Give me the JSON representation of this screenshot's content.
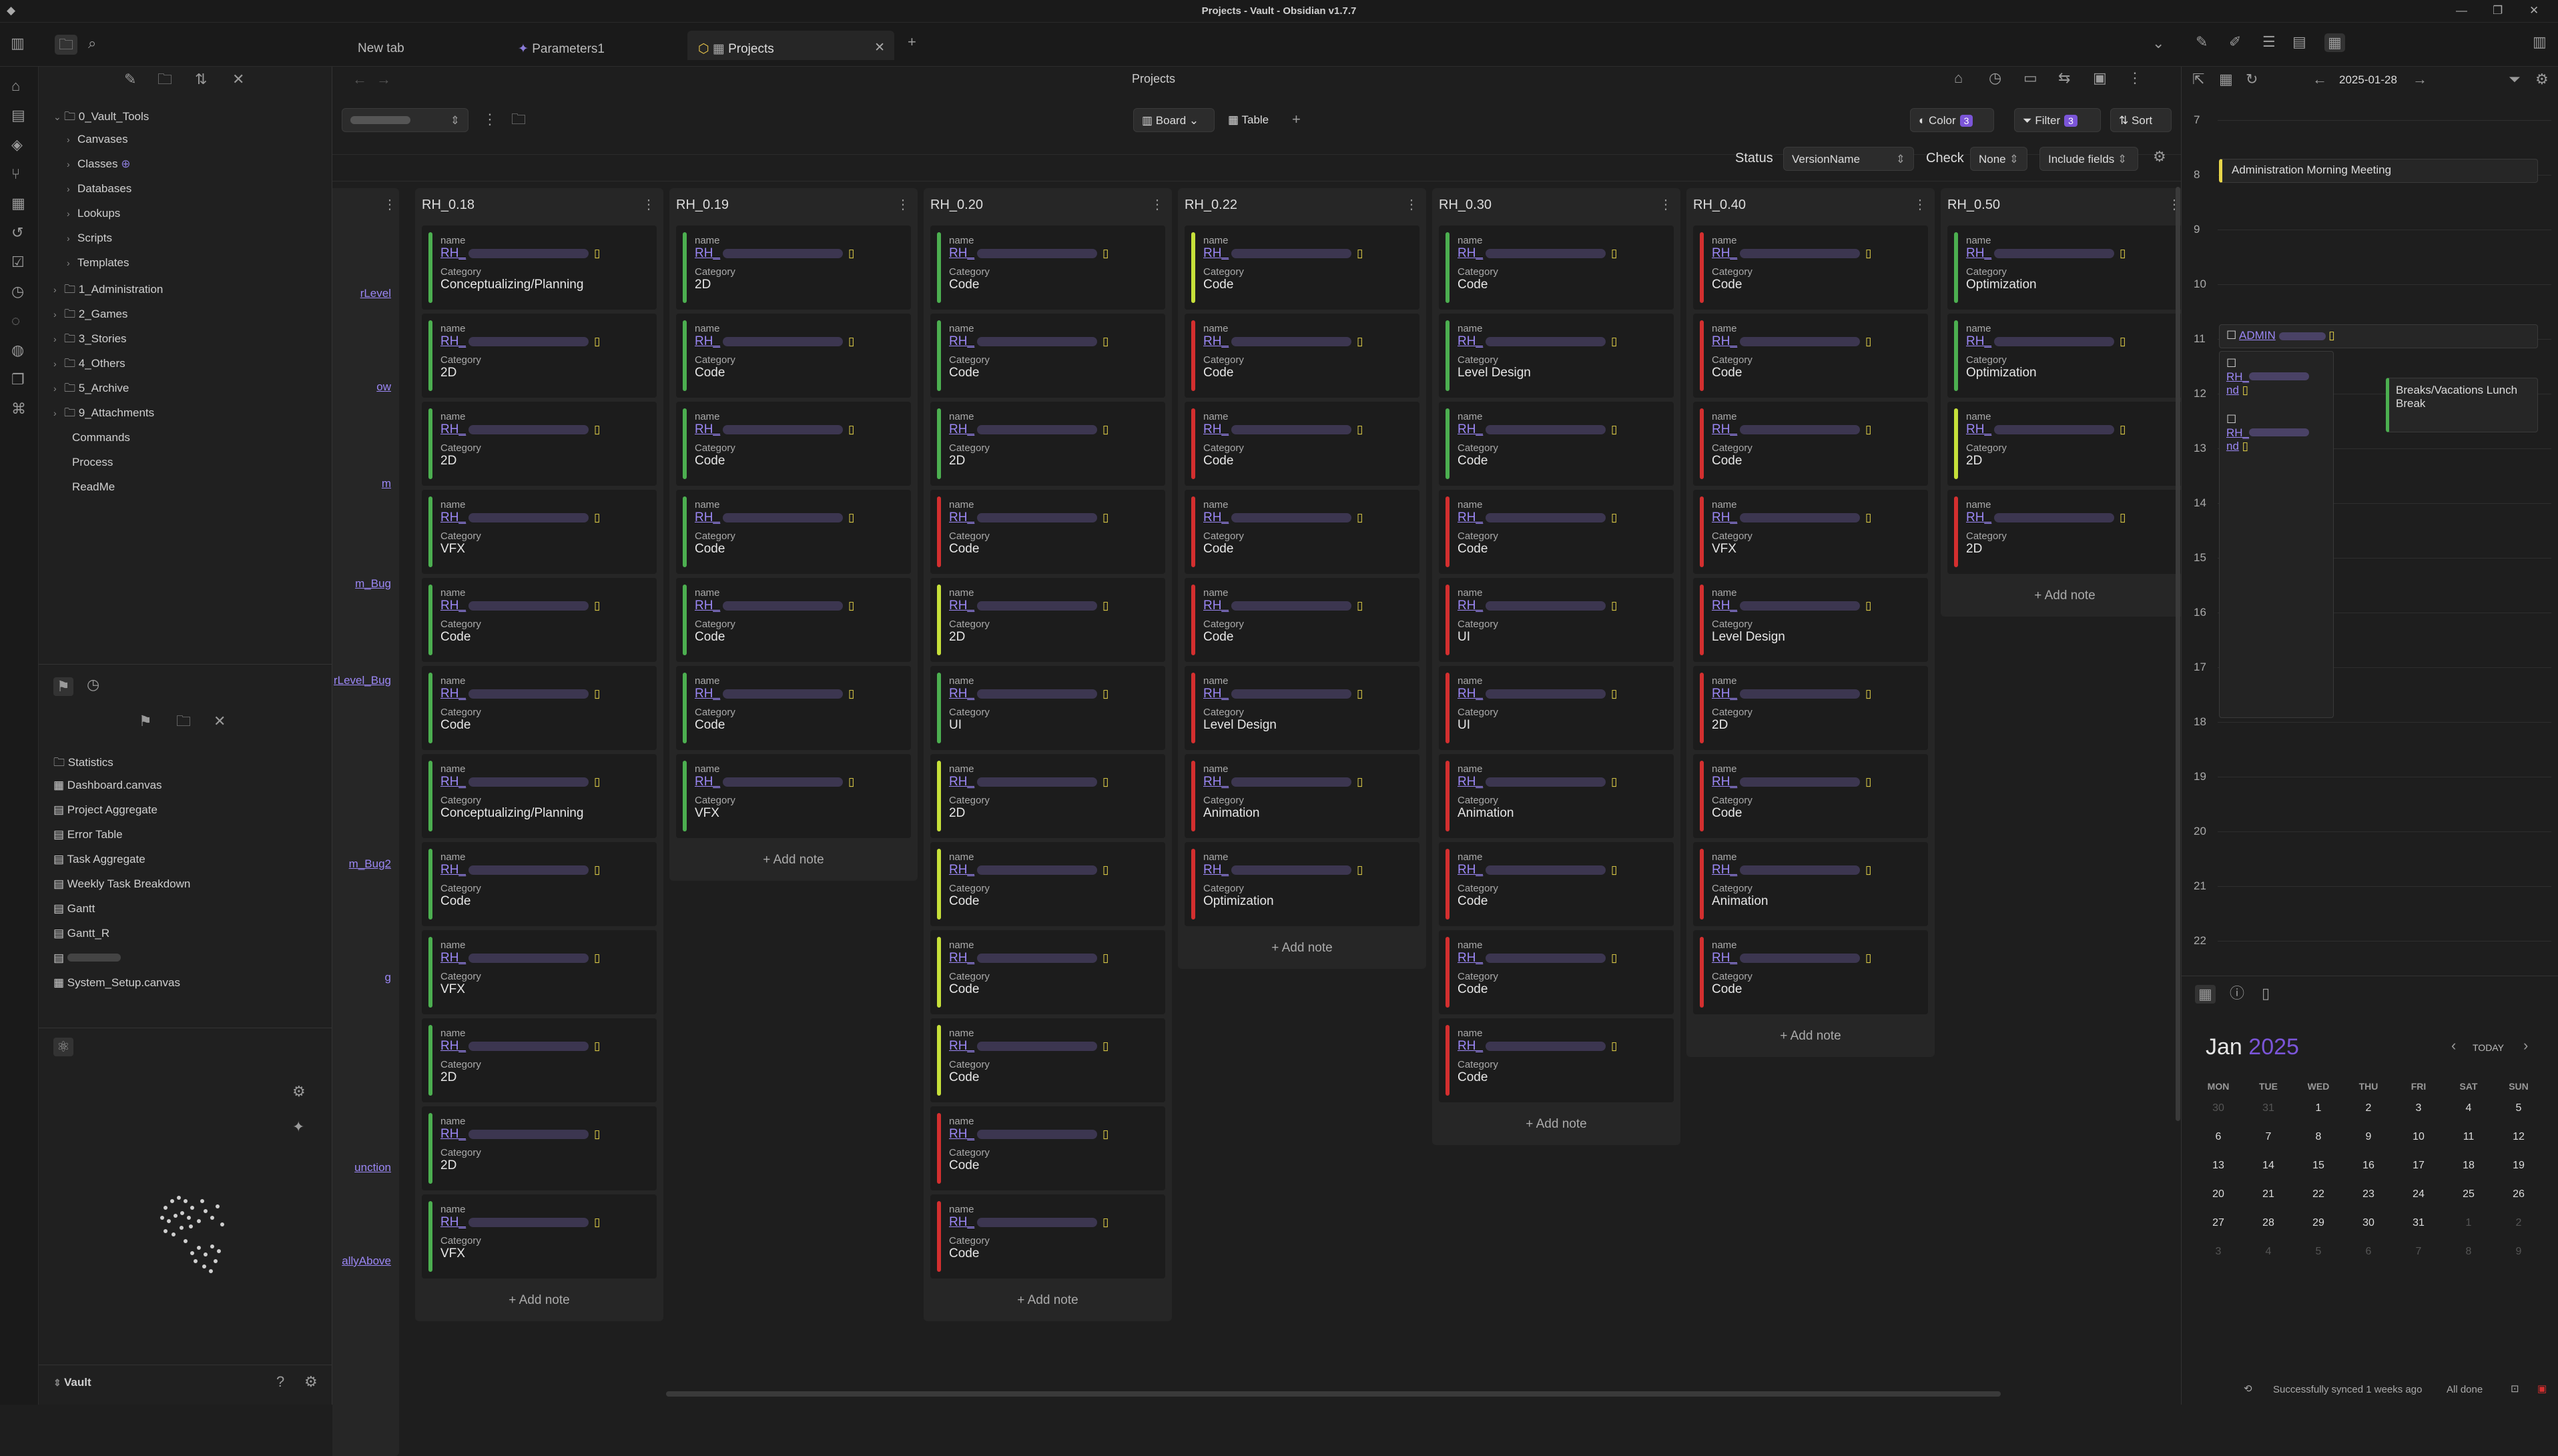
{
  "window": {
    "title": "Projects - Vault - Obsidian v1.7.7"
  },
  "tabs": [
    {
      "label": "New tab"
    },
    {
      "label": "Parameters1"
    },
    {
      "label": "Projects"
    }
  ],
  "explorer": {
    "root": "0_Vault_Tools",
    "children": [
      "Canvases",
      "Classes",
      "Databases",
      "Lookups",
      "Scripts",
      "Templates"
    ],
    "folders": [
      "1_Administration",
      "2_Games",
      "3_Stories",
      "4_Others",
      "5_Archive",
      "9_Attachments"
    ],
    "files": [
      "Commands",
      "Process",
      "ReadMe"
    ]
  },
  "bookmarks": [
    "Statistics",
    "Dashboard.canvas",
    "Project Aggregate",
    "Error Table",
    "Task Aggregate",
    "Weekly Task Breakdown",
    "Gantt",
    "Gantt_R",
    "System_Setup.canvas"
  ],
  "vault": {
    "name": "Vault"
  },
  "main": {
    "title": "Projects",
    "views": {
      "board": "Board",
      "table": "Table"
    },
    "buttons": {
      "color": "Color",
      "color_count": "3",
      "filter": "Filter",
      "filter_count": "3",
      "sort": "Sort"
    },
    "status_label": "Status",
    "status_value": "VersionName",
    "check_label": "Check",
    "check_value": "None",
    "include_fields": "Include fields",
    "add_note": "Add note",
    "field_name": "name",
    "field_category": "Category",
    "link_prefix": "RH_",
    "partial_links": [
      "rLevel",
      "ow",
      "m",
      "m_Bug",
      "rLevel_Bug",
      "m_Bug2",
      "g",
      "unction",
      "allyAbove"
    ],
    "columns": [
      {
        "title": "RH_0.18",
        "cards": [
          {
            "cat": "Conceptualizing/Planning",
            "color": "#4caf50"
          },
          {
            "cat": "2D",
            "color": "#4caf50"
          },
          {
            "cat": "2D",
            "color": "#4caf50"
          },
          {
            "cat": "VFX",
            "color": "#4caf50"
          },
          {
            "cat": "Code",
            "color": "#4caf50"
          },
          {
            "cat": "Code",
            "color": "#4caf50"
          },
          {
            "cat": "Conceptualizing/Planning",
            "color": "#4caf50"
          },
          {
            "cat": "Code",
            "color": "#4caf50"
          },
          {
            "cat": "VFX",
            "color": "#4caf50"
          },
          {
            "cat": "2D",
            "color": "#4caf50"
          },
          {
            "cat": "2D",
            "color": "#4caf50"
          },
          {
            "cat": "VFX",
            "color": "#4caf50"
          }
        ]
      },
      {
        "title": "RH_0.19",
        "cards": [
          {
            "cat": "2D",
            "color": "#4caf50"
          },
          {
            "cat": "Code",
            "color": "#4caf50"
          },
          {
            "cat": "Code",
            "color": "#4caf50"
          },
          {
            "cat": "Code",
            "color": "#4caf50"
          },
          {
            "cat": "Code",
            "color": "#4caf50"
          },
          {
            "cat": "Code",
            "color": "#4caf50"
          },
          {
            "cat": "VFX",
            "color": "#4caf50"
          }
        ]
      },
      {
        "title": "RH_0.20",
        "cards": [
          {
            "cat": "Code",
            "color": "#4caf50"
          },
          {
            "cat": "Code",
            "color": "#4caf50"
          },
          {
            "cat": "2D",
            "color": "#4caf50"
          },
          {
            "cat": "Code",
            "color": "#d32f2f"
          },
          {
            "cat": "2D",
            "color": "#c6e03a"
          },
          {
            "cat": "UI",
            "color": "#4caf50"
          },
          {
            "cat": "2D",
            "color": "#c6e03a"
          },
          {
            "cat": "Code",
            "color": "#c6e03a"
          },
          {
            "cat": "Code",
            "color": "#c6e03a"
          },
          {
            "cat": "Code",
            "color": "#c6e03a"
          },
          {
            "cat": "Code",
            "color": "#d32f2f"
          },
          {
            "cat": "Code",
            "color": "#d32f2f"
          }
        ]
      },
      {
        "title": "RH_0.22",
        "cards": [
          {
            "cat": "Code",
            "color": "#c6e03a"
          },
          {
            "cat": "Code",
            "color": "#d32f2f"
          },
          {
            "cat": "Code",
            "color": "#d32f2f"
          },
          {
            "cat": "Code",
            "color": "#d32f2f"
          },
          {
            "cat": "Code",
            "color": "#d32f2f"
          },
          {
            "cat": "Level Design",
            "color": "#d32f2f"
          },
          {
            "cat": "Animation",
            "color": "#d32f2f"
          },
          {
            "cat": "Optimization",
            "color": "#d32f2f"
          }
        ]
      },
      {
        "title": "RH_0.30",
        "cards": [
          {
            "cat": "Code",
            "color": "#4caf50"
          },
          {
            "cat": "Level Design",
            "color": "#4caf50"
          },
          {
            "cat": "Code",
            "color": "#4caf50"
          },
          {
            "cat": "Code",
            "color": "#d32f2f"
          },
          {
            "cat": "UI",
            "color": "#d32f2f"
          },
          {
            "cat": "UI",
            "color": "#d32f2f"
          },
          {
            "cat": "Animation",
            "color": "#d32f2f"
          },
          {
            "cat": "Code",
            "color": "#d32f2f"
          },
          {
            "cat": "Code",
            "color": "#d32f2f"
          },
          {
            "cat": "Code",
            "color": "#d32f2f"
          }
        ]
      },
      {
        "title": "RH_0.40",
        "cards": [
          {
            "cat": "Code",
            "color": "#d32f2f"
          },
          {
            "cat": "Code",
            "color": "#d32f2f"
          },
          {
            "cat": "Code",
            "color": "#d32f2f"
          },
          {
            "cat": "VFX",
            "color": "#d32f2f"
          },
          {
            "cat": "Level Design",
            "color": "#d32f2f"
          },
          {
            "cat": "2D",
            "color": "#d32f2f"
          },
          {
            "cat": "Code",
            "color": "#d32f2f"
          },
          {
            "cat": "Animation",
            "color": "#d32f2f"
          },
          {
            "cat": "Code",
            "color": "#d32f2f"
          }
        ]
      },
      {
        "title": "RH_0.50",
        "cards": [
          {
            "cat": "Optimization",
            "color": "#4caf50"
          },
          {
            "cat": "Optimization",
            "color": "#4caf50"
          },
          {
            "cat": "2D",
            "color": "#c6e03a"
          },
          {
            "cat": "2D",
            "color": "#d32f2f"
          }
        ]
      }
    ]
  },
  "calendar": {
    "date": "2025-01-28",
    "hours": [
      "7",
      "8",
      "9",
      "10",
      "11",
      "12",
      "13",
      "14",
      "15",
      "16",
      "17",
      "18",
      "19",
      "20",
      "21",
      "22"
    ],
    "events": {
      "morning": "Administration Morning Meeting",
      "admin": "ADMIN",
      "break": "Breaks/Vacations Lunch Break",
      "nd": "nd"
    },
    "month": "Jan",
    "year": "2025",
    "today": "TODAY",
    "weekdays": [
      "MON",
      "TUE",
      "WED",
      "THU",
      "FRI",
      "SAT",
      "SUN"
    ],
    "weeks": [
      [
        "30",
        "31",
        "1",
        "2",
        "3",
        "4",
        "5"
      ],
      [
        "6",
        "7",
        "8",
        "9",
        "10",
        "11",
        "12"
      ],
      [
        "13",
        "14",
        "15",
        "16",
        "17",
        "18",
        "19"
      ],
      [
        "20",
        "21",
        "22",
        "23",
        "24",
        "25",
        "26"
      ],
      [
        "27",
        "28",
        "29",
        "30",
        "31",
        "1",
        "2"
      ],
      [
        "3",
        "4",
        "5",
        "6",
        "7",
        "8",
        "9"
      ]
    ]
  },
  "statusbar": {
    "sync": "Successfully synced 1 weeks ago",
    "done": "All done"
  },
  "colors": {
    "accent": "#7b55d8",
    "green": "#4caf50",
    "red": "#d32f2f",
    "yellow": "#c6e03a",
    "link": "#9b87f5"
  }
}
